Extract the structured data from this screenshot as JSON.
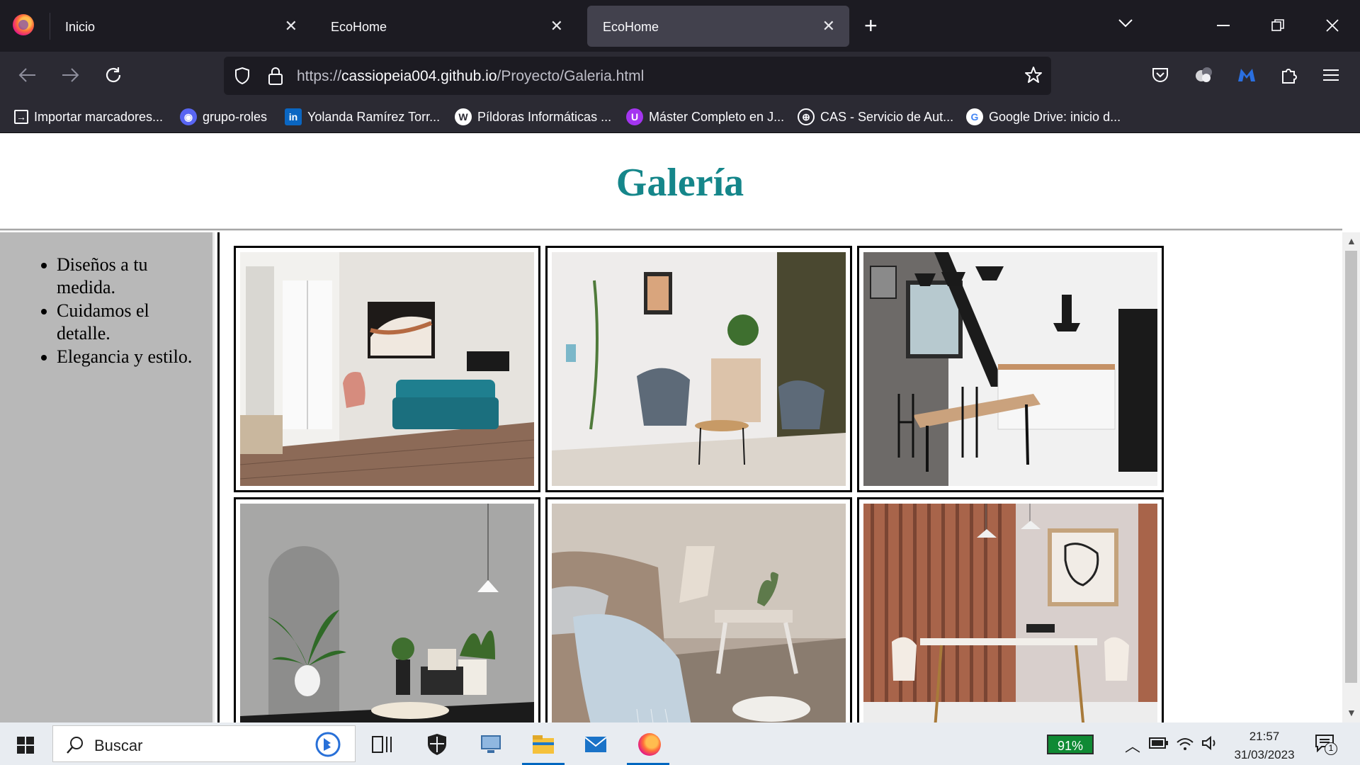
{
  "browser": {
    "tabs": [
      {
        "label": "Inicio",
        "active": false
      },
      {
        "label": "EcoHome",
        "active": false
      },
      {
        "label": "EcoHome",
        "active": true
      }
    ],
    "close_glyph": "✕",
    "new_tab_glyph": "+",
    "url_host": "cassiopeia004.github.io",
    "url_prefix": "https://",
    "url_path": "/Proyecto/Galeria.html",
    "bookmarks": [
      {
        "label": "Importar marcadores...",
        "icon": "import-icon",
        "color": "#2b2a33"
      },
      {
        "label": "grupo-roles",
        "icon": "discord-icon",
        "color": "#5865f2"
      },
      {
        "label": "Yolanda Ramírez Torr...",
        "icon": "linkedin-icon",
        "color": "#0a66c2"
      },
      {
        "label": "Píldoras Informáticas ...",
        "icon": "wordpress-icon",
        "color": "#ffffff"
      },
      {
        "label": "Máster Completo en J...",
        "icon": "udemy-icon",
        "color": "#a435f0"
      },
      {
        "label": "CAS - Servicio de Aut...",
        "icon": "globe-icon",
        "color": "#2b2a33"
      },
      {
        "label": "Google Drive: inicio d...",
        "icon": "google-icon",
        "color": "#ffffff"
      }
    ]
  },
  "page": {
    "title": "Galería",
    "features": [
      "Diseños a tu medida.",
      "Cuidamos el detalle.",
      "Elegancia y estilo."
    ],
    "title_color": "#15868a",
    "gallery": [
      {
        "name": "living-room-blue-sofa-photo"
      },
      {
        "name": "lounge-chairs-plants-photo"
      },
      {
        "name": "kitchen-dining-table-photo"
      },
      {
        "name": "arch-niche-palm-photo"
      },
      {
        "name": "bedroom-throw-blanket-photo"
      },
      {
        "name": "dining-wood-slats-photo"
      }
    ]
  },
  "taskbar": {
    "search_placeholder": "Buscar",
    "battery": "91%",
    "time": "21:57",
    "date": "31/03/2023",
    "notification_count": "1"
  }
}
